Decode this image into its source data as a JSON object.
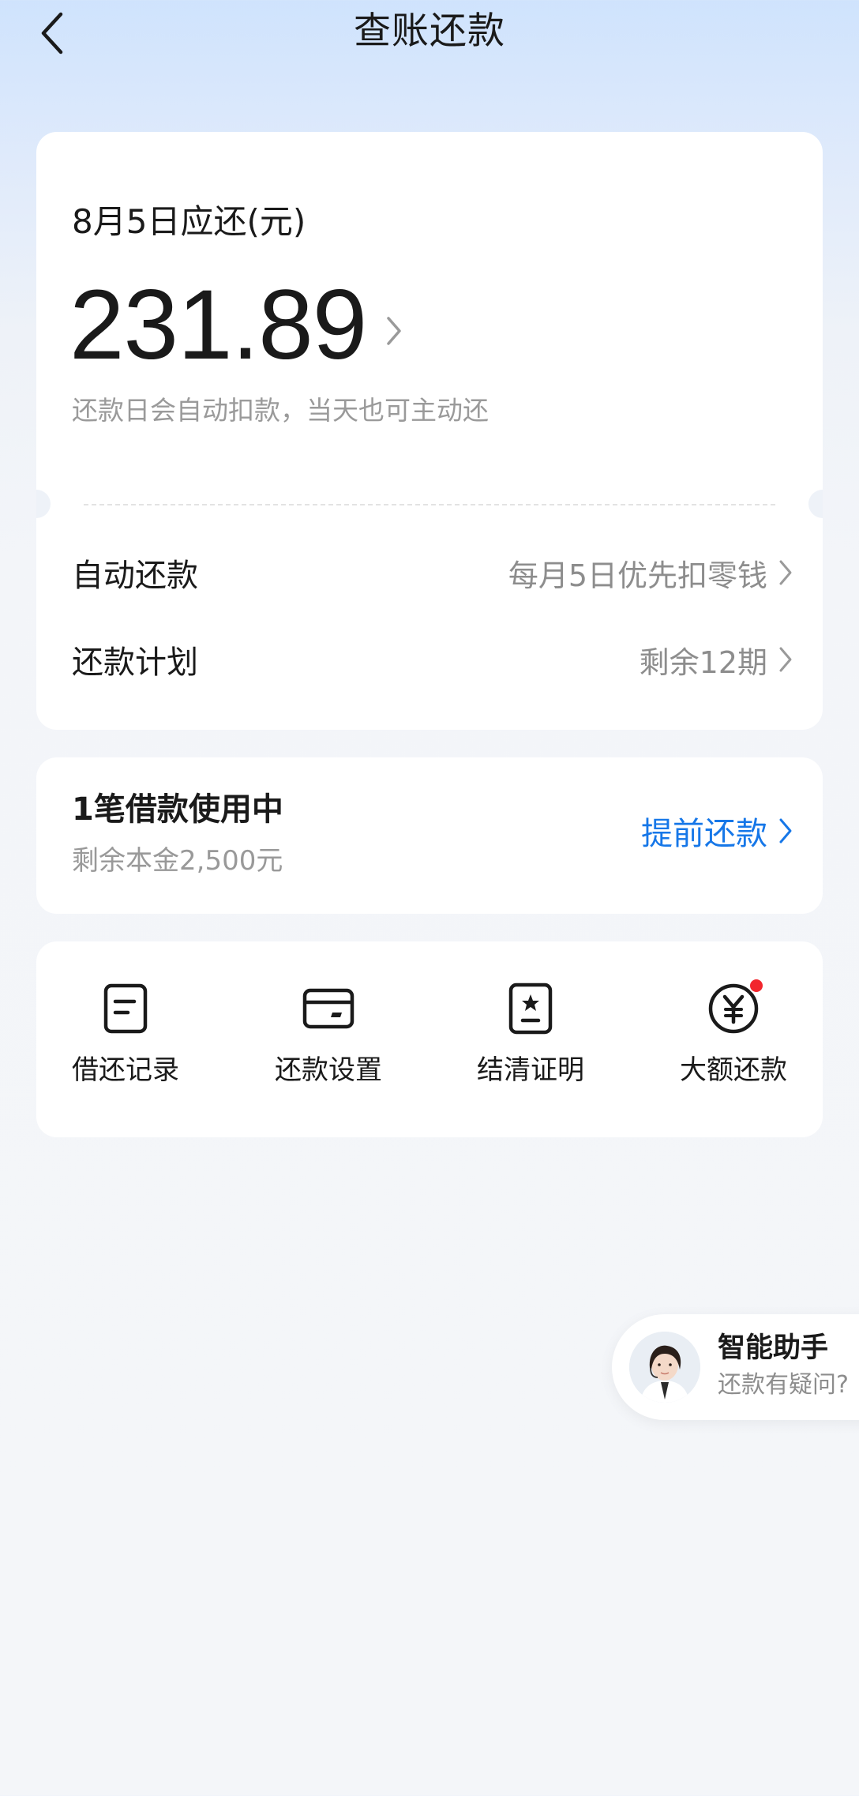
{
  "header": {
    "title": "查账还款"
  },
  "bill": {
    "due_label": "8月5日应还(元)",
    "amount": "231.89",
    "hint": "还款日会自动扣款，当天也可主动还",
    "auto_repay": {
      "label": "自动还款",
      "value": "每月5日优先扣零钱"
    },
    "plan": {
      "label": "还款计划",
      "value": "剩余12期"
    }
  },
  "loan": {
    "title": "1笔借款使用中",
    "subtitle": "剩余本金2,500元",
    "action": "提前还款"
  },
  "tools": [
    {
      "label": "借还记录",
      "icon": "record-icon"
    },
    {
      "label": "还款设置",
      "icon": "card-settings-icon"
    },
    {
      "label": "结清证明",
      "icon": "certificate-icon"
    },
    {
      "label": "大额还款",
      "icon": "yuan-coin-icon",
      "badge": true
    }
  ],
  "assistant": {
    "title": "智能助手",
    "subtitle": "还款有疑问?"
  },
  "colors": {
    "accent": "#1677e8",
    "badge": "#f2262d",
    "muted": "#999999"
  }
}
